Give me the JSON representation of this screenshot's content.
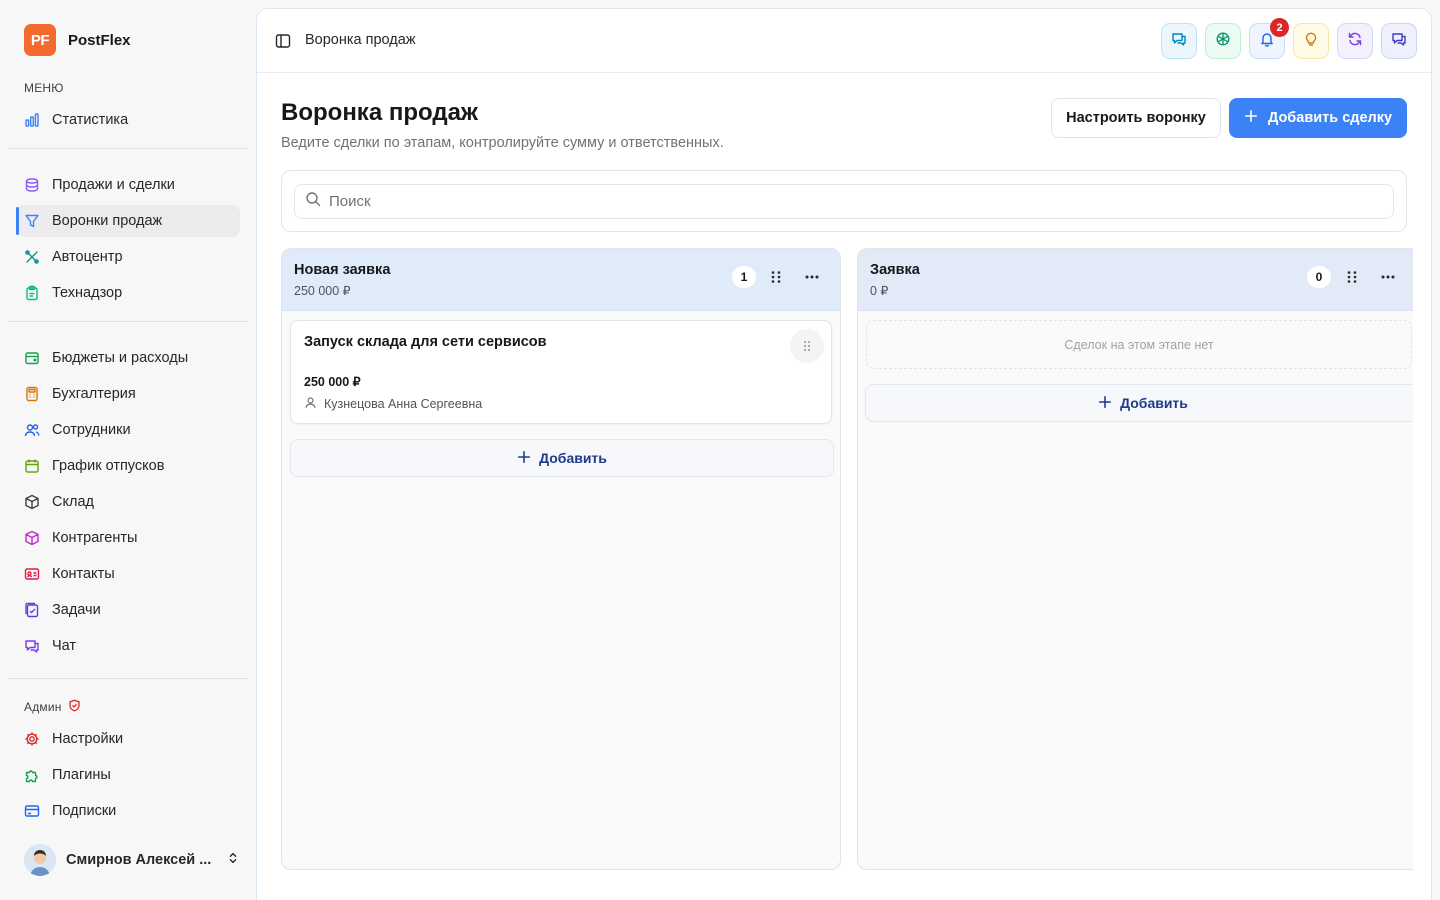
{
  "brand": {
    "logo_text": "PF",
    "name": "PostFlex"
  },
  "sidebar": {
    "menu_label": "МЕНЮ",
    "group1": [
      {
        "label": "Статистика",
        "icon": "bar-chart-icon"
      }
    ],
    "group2": [
      {
        "label": "Продажи и сделки",
        "icon": "database-icon"
      },
      {
        "label": "Воронки продаж",
        "icon": "funnel-icon",
        "active": true
      },
      {
        "label": "Автоцентр",
        "icon": "wrench-icon"
      },
      {
        "label": "Технадзор",
        "icon": "clipboard-icon"
      }
    ],
    "group3": [
      {
        "label": "Бюджеты и расходы",
        "icon": "wallet-icon"
      },
      {
        "label": "Бухгалтерия",
        "icon": "calculator-icon"
      },
      {
        "label": "Сотрудники",
        "icon": "users-icon"
      },
      {
        "label": "График отпусков",
        "icon": "calendar-icon"
      },
      {
        "label": "Склад",
        "icon": "box-icon"
      },
      {
        "label": "Контрагенты",
        "icon": "package-icon"
      },
      {
        "label": "Контакты",
        "icon": "contact-card-icon"
      },
      {
        "label": "Задачи",
        "icon": "tasks-icon"
      },
      {
        "label": "Чат",
        "icon": "chat-icon"
      }
    ],
    "admin_label": "Админ",
    "admin": [
      {
        "label": "Настройки",
        "icon": "gear-icon"
      },
      {
        "label": "Плагины",
        "icon": "puzzle-icon"
      },
      {
        "label": "Подписки",
        "icon": "credit-card-icon"
      }
    ],
    "user_name": "Смирнов Алексей ..."
  },
  "header": {
    "breadcrumb": "Воронка продаж",
    "notifications_count": "2"
  },
  "page": {
    "title": "Воронка продаж",
    "subtitle": "Ведите сделки по этапам, контролируйте сумму и ответственных.",
    "configure_label": "Настроить воронку",
    "add_deal_label": "Добавить сделку"
  },
  "search": {
    "placeholder": "Поиск"
  },
  "columns": [
    {
      "title": "Новая заявка",
      "sum": "250 000 ₽",
      "count": "1",
      "cards": [
        {
          "title": "Запуск склада для сети сервисов",
          "amount": "250 000 ₽",
          "person": "Кузнецова Анна Сергеевна"
        }
      ],
      "add_label": "Добавить"
    },
    {
      "title": "Заявка",
      "sum": "0 ₽",
      "count": "0",
      "empty_text": "Сделок на этом этапе нет",
      "add_label": "Добавить"
    }
  ],
  "colors": {
    "accent": "#3b82f6",
    "brand": "#f26a2e",
    "badge": "#dc2626",
    "column_head": "#dfebf8"
  }
}
